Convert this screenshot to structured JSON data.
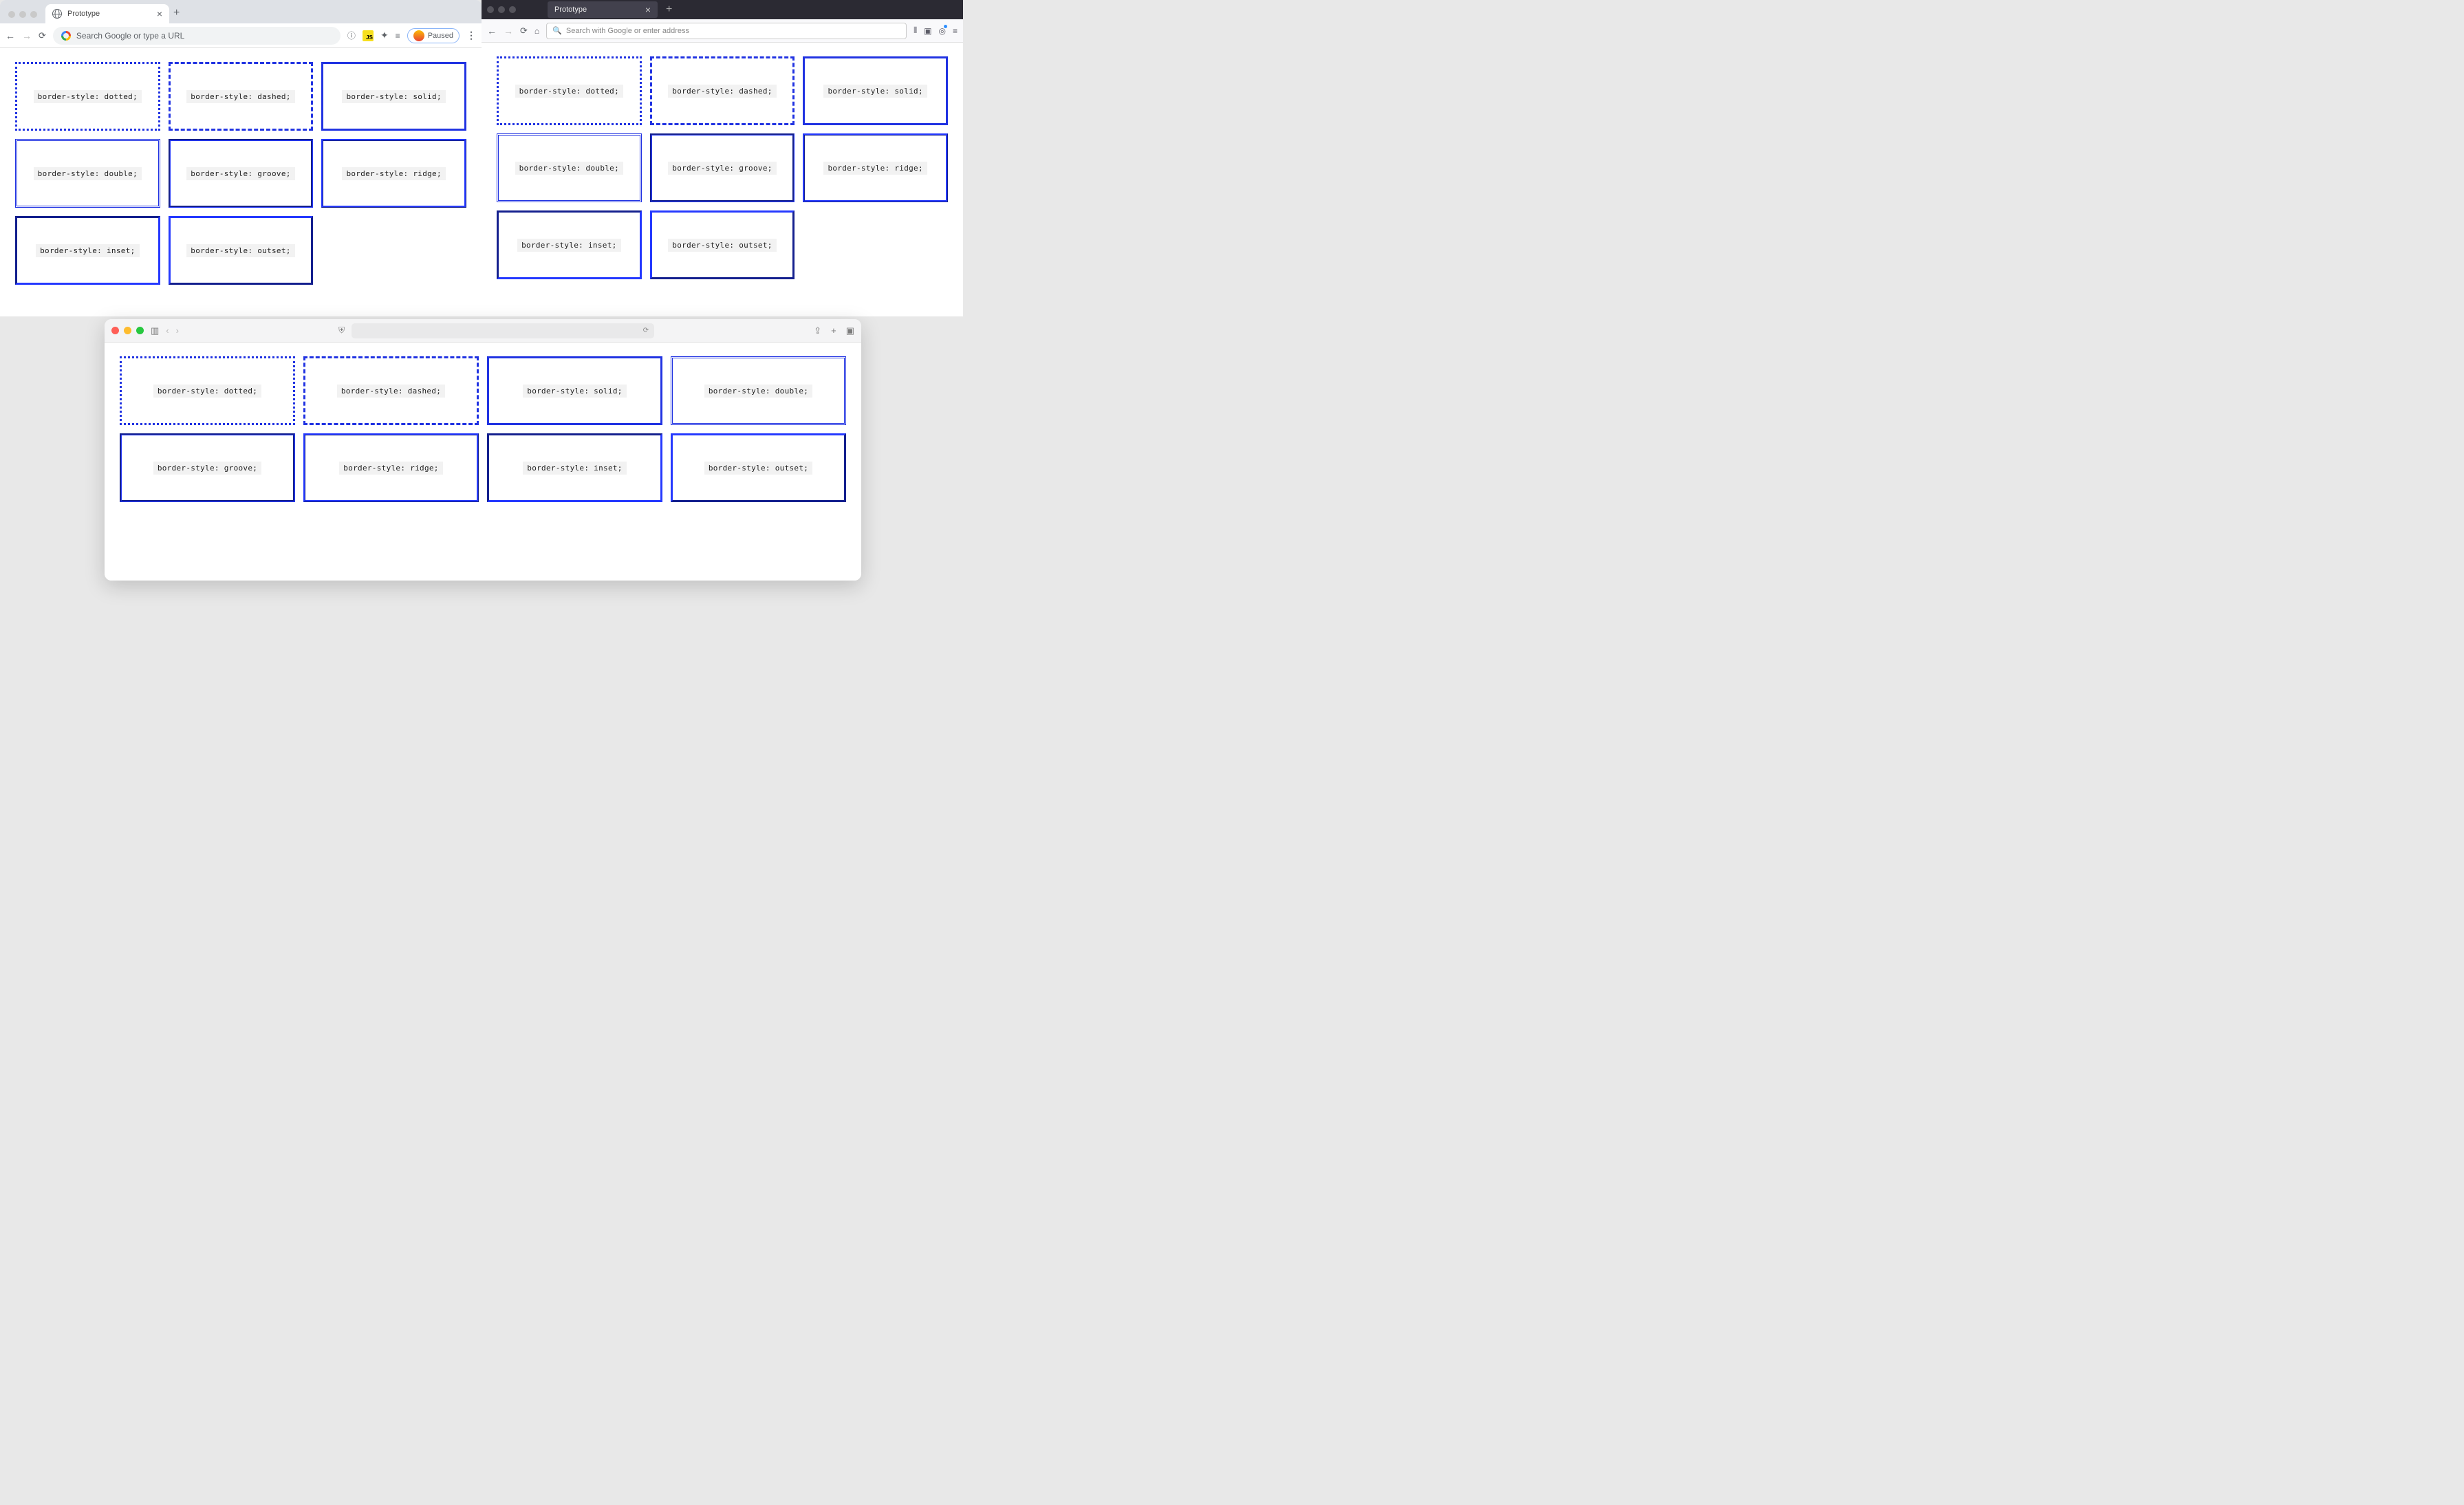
{
  "border_color": "#2133e2",
  "chrome": {
    "tab_title": "Prototype",
    "omnibox_placeholder": "Search Google or type a URL",
    "profile_label": "Paused",
    "boxes": [
      "border-style: dotted;",
      "border-style: dashed;",
      "border-style: solid;",
      "border-style: double;",
      "border-style: groove;",
      "border-style: ridge;",
      "border-style: inset;",
      "border-style: outset;"
    ]
  },
  "firefox": {
    "tab_title": "Prototype",
    "urlbar_placeholder": "Search with Google or enter address",
    "boxes": [
      "border-style: dotted;",
      "border-style: dashed;",
      "border-style: solid;",
      "border-style: double;",
      "border-style: groove;",
      "border-style: ridge;",
      "border-style: inset;",
      "border-style: outset;"
    ]
  },
  "safari": {
    "boxes": [
      "border-style: dotted;",
      "border-style: dashed;",
      "border-style: solid;",
      "border-style: double;",
      "border-style: groove;",
      "border-style: ridge;",
      "border-style: inset;",
      "border-style: outset;"
    ]
  },
  "box_styles": [
    "dotted",
    "dashed",
    "solid",
    "double",
    "groove",
    "ridge",
    "inset",
    "outset"
  ]
}
